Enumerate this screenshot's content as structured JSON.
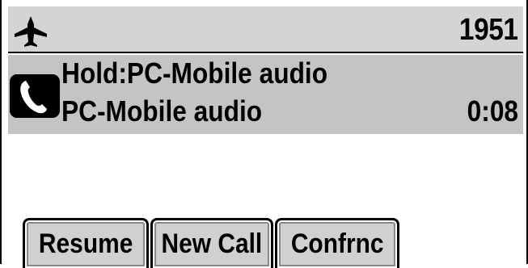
{
  "status_bar": {
    "left_icon": "airplane-icon",
    "extension": "1951"
  },
  "call": {
    "icon": "phone-handset-icon",
    "line1": "Hold:PC-Mobile audio",
    "line2": "PC-Mobile audio",
    "timer": "0:08"
  },
  "softkeys": [
    {
      "label": "Resume"
    },
    {
      "label": "New Call"
    },
    {
      "label": "Confrnc"
    }
  ],
  "colors": {
    "status_bar_bg": "#d4d4d4",
    "call_panel_bg": "#c4c4c4",
    "text": "#000000",
    "background": "#ffffff"
  }
}
